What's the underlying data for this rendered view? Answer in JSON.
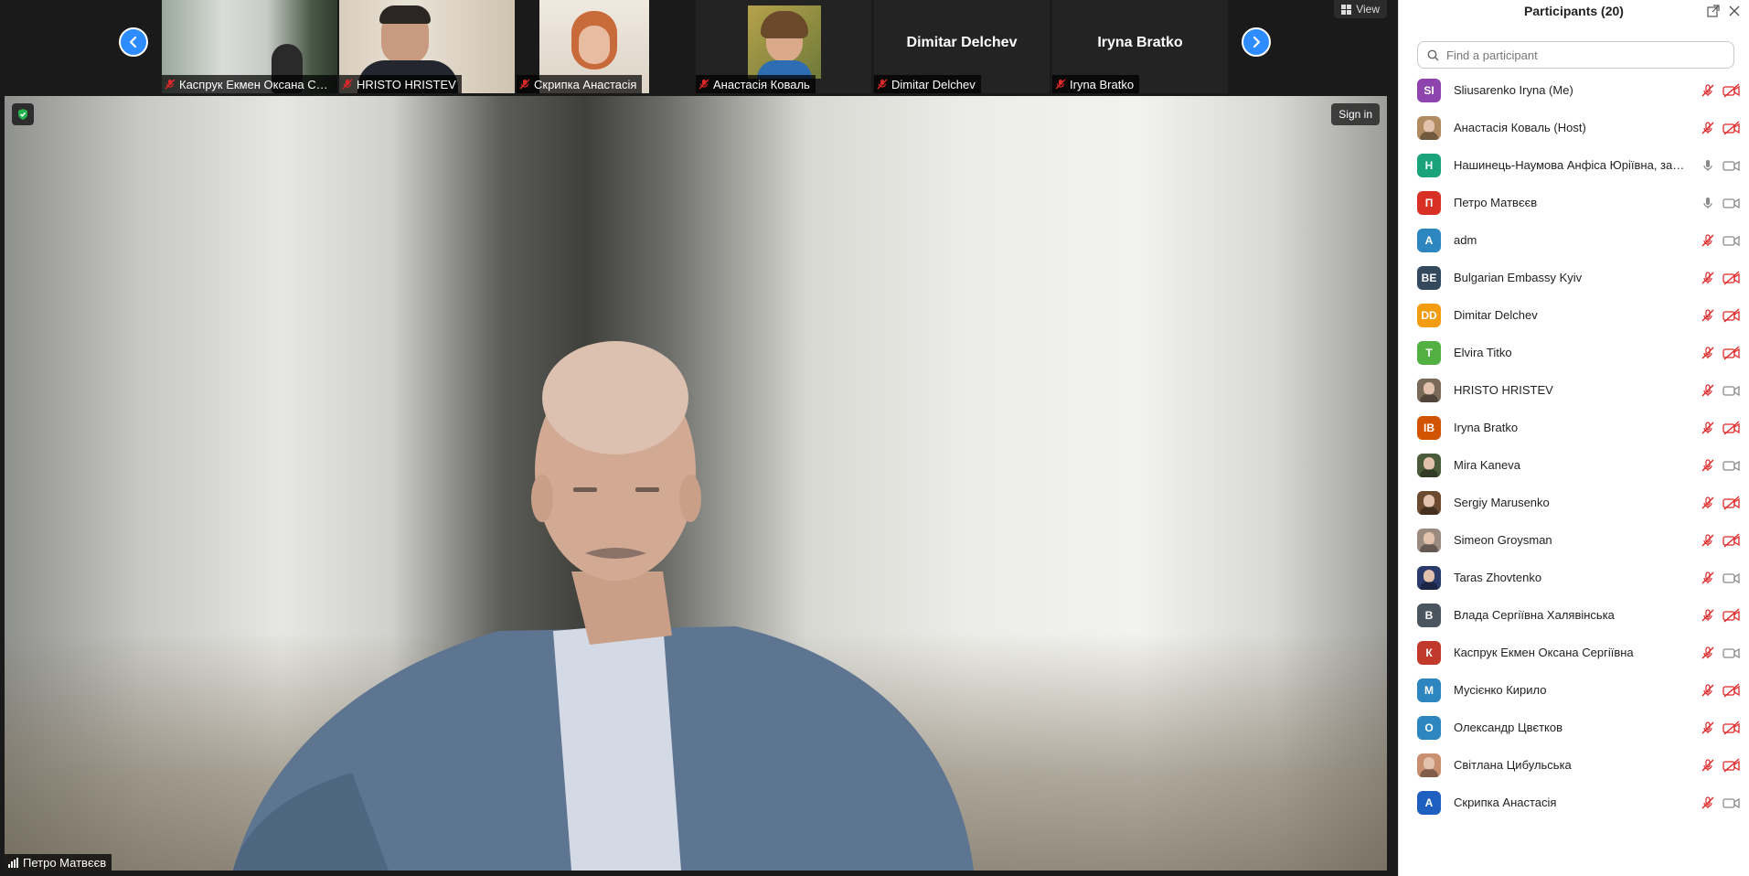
{
  "colors": {
    "accent_blue": "#2d8cff",
    "muted_red": "#e02828",
    "icon_gray": "#8a8a8a",
    "dark_bg": "#1a1a1a"
  },
  "strip": {
    "view_label": "View",
    "prev_icon": "chevron-left-icon",
    "next_icon": "chevron-right-icon",
    "thumbnails": [
      {
        "name": "Каспрук Екмен Оксана Се...",
        "type": "video"
      },
      {
        "name": "HRISTO HRISTEV",
        "type": "video"
      },
      {
        "name": "Скрипка Анастасія",
        "type": "video"
      },
      {
        "name": "Анастасія Коваль",
        "type": "video"
      },
      {
        "name": "Dimitar Delchev",
        "type": "name-only",
        "big_name": "Dimitar Delchev"
      },
      {
        "name": "Iryna Bratko",
        "type": "name-only",
        "big_name": "Iryna Bratko"
      }
    ]
  },
  "main_video": {
    "speaker_name": "Петро Матвєєв",
    "sign_in_label": "Sign in",
    "security_icon": "shield-check-icon"
  },
  "panel": {
    "title": "Participants (20)",
    "search_placeholder": "Find a participant",
    "participants": [
      {
        "name": "Sliusarenko Iryna (Me)",
        "initials": "SI",
        "color": "#8e44ad",
        "mic": "muted",
        "cam": "off"
      },
      {
        "name": "Анастасія Коваль (Host)",
        "initials": "",
        "color": "#b08a60",
        "mic": "muted",
        "cam": "off",
        "photo": true
      },
      {
        "name": "Нашинець-Наумова Анфіса Юріївна, заст...",
        "initials": "Н",
        "color": "#1aa37a",
        "mic": "on",
        "cam": "on"
      },
      {
        "name": "Петро Матвєєв",
        "initials": "П",
        "color": "#d93025",
        "mic": "on",
        "cam": "on"
      },
      {
        "name": "adm",
        "initials": "A",
        "color": "#2e86c1",
        "mic": "muted",
        "cam": "on"
      },
      {
        "name": "Bulgarian Embassy Kyiv",
        "initials": "BE",
        "color": "#34495e",
        "mic": "muted",
        "cam": "off"
      },
      {
        "name": "Dimitar Delchev",
        "initials": "DD",
        "color": "#f39c12",
        "mic": "muted",
        "cam": "off"
      },
      {
        "name": "Elvira Titko",
        "initials": "T",
        "color": "#52b043",
        "mic": "muted",
        "cam": "off"
      },
      {
        "name": "HRISTO HRISTEV",
        "initials": "",
        "color": "#7a6a5a",
        "mic": "muted",
        "cam": "on",
        "photo": true
      },
      {
        "name": "Iryna Bratko",
        "initials": "IB",
        "color": "#d35400",
        "mic": "muted",
        "cam": "off"
      },
      {
        "name": "Mira Kaneva",
        "initials": "",
        "color": "#4a5a3a",
        "mic": "muted",
        "cam": "on",
        "photo": true
      },
      {
        "name": "Sergiy Marusenko",
        "initials": "",
        "color": "#6b4a30",
        "mic": "muted",
        "cam": "off",
        "photo": true
      },
      {
        "name": "Simeon Groysman",
        "initials": "",
        "color": "#9a8a80",
        "mic": "muted",
        "cam": "off",
        "photo": true
      },
      {
        "name": "Taras Zhovtenko",
        "initials": "",
        "color": "#2a3a6a",
        "mic": "muted",
        "cam": "on",
        "photo": true
      },
      {
        "name": "Влада Сергіївна Халявінська",
        "initials": "В",
        "color": "#4a5560",
        "mic": "muted",
        "cam": "off"
      },
      {
        "name": "Каспрук Екмен Оксана Сергіївна",
        "initials": "К",
        "color": "#c0392b",
        "mic": "muted",
        "cam": "on"
      },
      {
        "name": "Мусієнко Кирило",
        "initials": "М",
        "color": "#2e86c1",
        "mic": "muted",
        "cam": "off"
      },
      {
        "name": "Олександр Цвєтков",
        "initials": "О",
        "color": "#2e86c1",
        "mic": "muted",
        "cam": "off"
      },
      {
        "name": "Світлана Цибульська",
        "initials": "",
        "color": "#c89070",
        "mic": "muted",
        "cam": "off",
        "photo": true
      },
      {
        "name": "Скрипка Анастасія",
        "initials": "А",
        "color": "#1f5fbf",
        "mic": "muted",
        "cam": "on"
      }
    ]
  }
}
